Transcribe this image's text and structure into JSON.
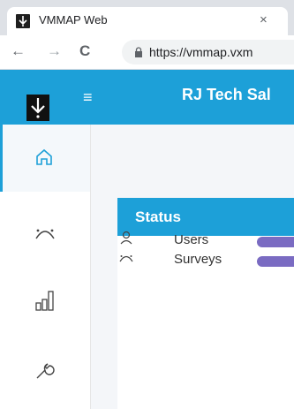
{
  "browser": {
    "tab_title": "VMMAP Web",
    "tab_close": "×",
    "back_icon": "←",
    "forward_icon": "→",
    "reload_icon": "C",
    "url": "https://vmmap.vxm"
  },
  "app": {
    "menu_icon": "≡",
    "title": "RJ Tech Sal",
    "accent_color": "#1da0d8",
    "bar_color": "#7a6bc2"
  },
  "sidebar": {
    "items": [
      {
        "icon": "home-icon",
        "active": true
      },
      {
        "icon": "survey-icon",
        "active": false
      },
      {
        "icon": "chart-icon",
        "active": false
      },
      {
        "icon": "wrench-icon",
        "active": false
      }
    ]
  },
  "status": {
    "title": "Status",
    "rows": [
      {
        "icon": "users-icon",
        "label": "Users"
      },
      {
        "icon": "survey-icon",
        "label": "Surveys"
      }
    ]
  }
}
